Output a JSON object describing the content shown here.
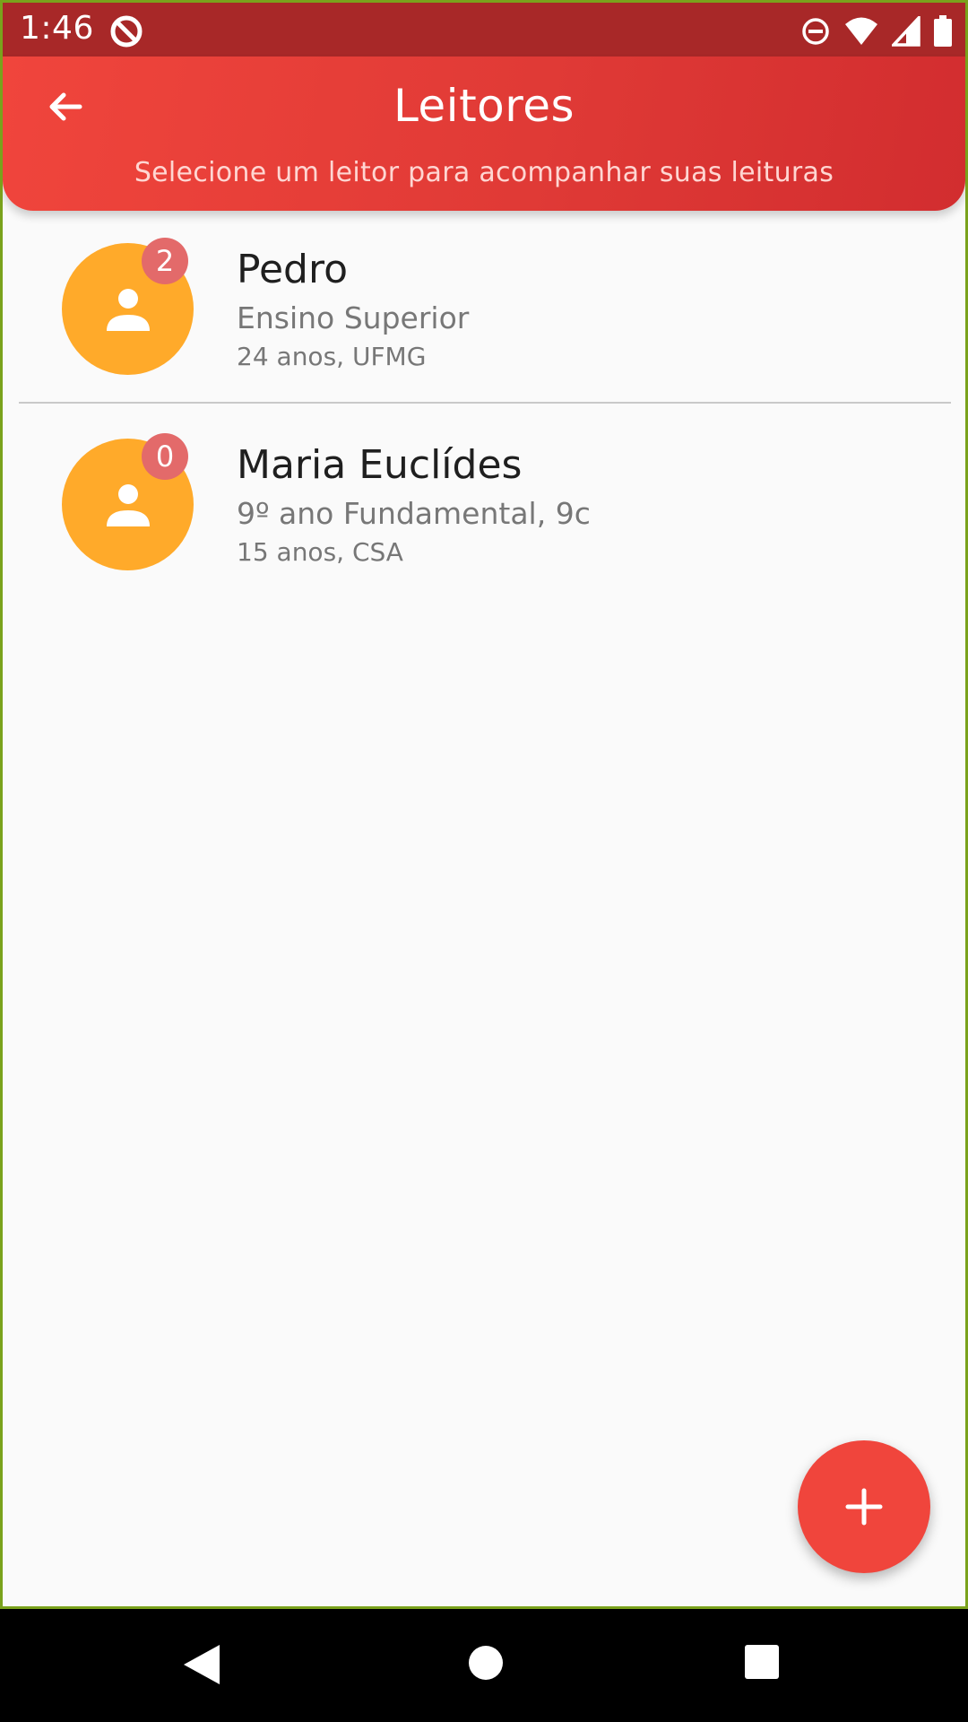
{
  "status_bar": {
    "time": "1:46",
    "icons": [
      "data-saver-icon",
      "do-not-disturb-icon",
      "wifi-icon",
      "cell-signal-icon",
      "battery-icon"
    ]
  },
  "app_bar": {
    "title": "Leitores",
    "subtitle": "Selecione um leitor para acompanhar suas leituras",
    "back_icon": "arrow-back-icon"
  },
  "readers": [
    {
      "badge": "2",
      "name": "Pedro",
      "level": "Ensino Superior",
      "meta": "24 anos, UFMG",
      "icon": "person-icon"
    },
    {
      "badge": "0",
      "name": "Maria Euclídes",
      "level": "9º ano Fundamental, 9c",
      "meta": "15 anos, CSA",
      "icon": "person-icon"
    }
  ],
  "fab": {
    "icon": "plus-icon"
  },
  "nav_bar": {
    "icons": [
      "nav-back-icon",
      "nav-home-icon",
      "nav-recents-icon"
    ]
  },
  "colors": {
    "app_bar": "#e03a36",
    "status_bar": "#a82828",
    "avatar": "#ffaa2a",
    "badge": "#e36a6a",
    "fab": "#f0453c",
    "background": "#fafafa"
  }
}
